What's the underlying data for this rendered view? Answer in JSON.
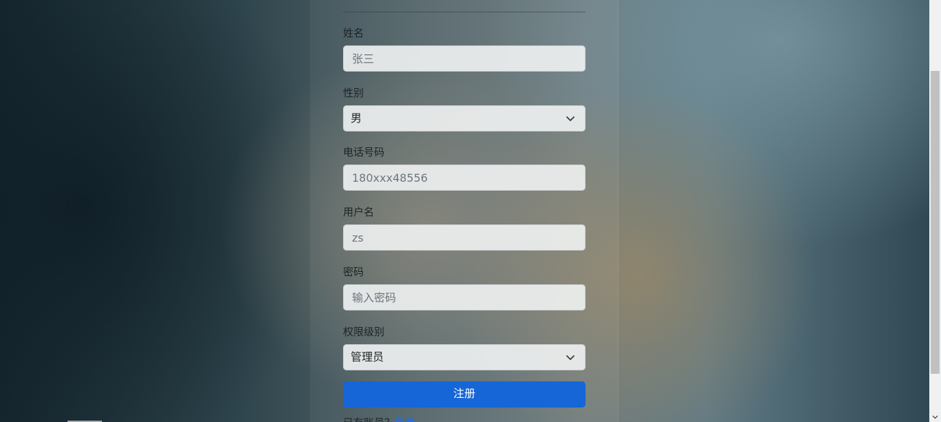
{
  "form": {
    "name": {
      "label": "姓名",
      "value": "",
      "placeholder": "张三"
    },
    "gender": {
      "label": "性别",
      "selected": "男"
    },
    "phone": {
      "label": "电话号码",
      "value": "",
      "placeholder": "180xxx48556"
    },
    "username": {
      "label": "用户名",
      "value": "",
      "placeholder": "zs"
    },
    "password": {
      "label": "密码",
      "value": "",
      "placeholder": "输入密码"
    },
    "role": {
      "label": "权限级别",
      "selected": "管理员"
    },
    "submit_label": "注册",
    "login_prompt": {
      "text": "已有账号？",
      "link": "登录"
    }
  },
  "colors": {
    "primary_button": "#1666d8",
    "link": "#1a6cf0"
  },
  "icons": {
    "select_arrow": "chevron-down-icon"
  }
}
